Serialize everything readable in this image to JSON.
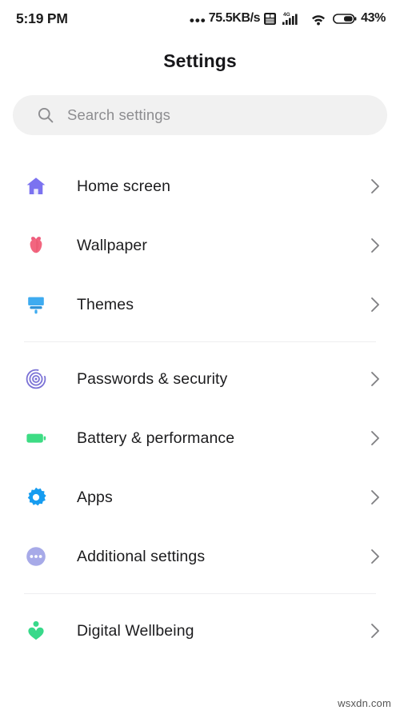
{
  "status_bar": {
    "clock": "5:19 PM",
    "network_prefix": "•••",
    "network_speed": "75.5KB/s",
    "sim_icon": "sim-card-icon",
    "network_type": "4G",
    "signal_icon": "cellular-signal-icon",
    "wifi_icon": "wifi-icon",
    "battery_icon": "battery-icon",
    "battery_percent": "43%"
  },
  "header": {
    "title": "Settings"
  },
  "search": {
    "icon": "search-icon",
    "placeholder": "Search settings",
    "value": ""
  },
  "colors": {
    "home": "#7b72f0",
    "wallpaper": "#f2667f",
    "themes": "#3eabf0",
    "passwords": "#7b72d6",
    "battery": "#3ddc84",
    "apps": "#169cf0",
    "additional": "#a7aae8",
    "wellbeing": "#38d98a",
    "search_bg": "#f1f1f1",
    "divider": "#eeeef0",
    "text": "#1c1c1e",
    "placeholder": "#8d8d90",
    "chevron": "#808083"
  },
  "groups": [
    {
      "items": [
        {
          "label": "Home screen",
          "icon": "home-icon",
          "color": "#7b72f0",
          "chevron": "chevron-right-icon"
        },
        {
          "label": "Wallpaper",
          "icon": "flower-icon",
          "color": "#f2667f",
          "chevron": "chevron-right-icon"
        },
        {
          "label": "Themes",
          "icon": "paint-brush-icon",
          "color": "#3eabf0",
          "chevron": "chevron-right-icon"
        }
      ]
    },
    {
      "items": [
        {
          "label": "Passwords & security",
          "icon": "fingerprint-icon",
          "color": "#7b72d6",
          "chevron": "chevron-right-icon"
        },
        {
          "label": "Battery & performance",
          "icon": "battery-icon",
          "color": "#3ddc84",
          "chevron": "chevron-right-icon"
        },
        {
          "label": "Apps",
          "icon": "gear-icon",
          "color": "#169cf0",
          "chevron": "chevron-right-icon"
        },
        {
          "label": "Additional settings",
          "icon": "three-dots-circle-icon",
          "color": "#a7aae8",
          "chevron": "chevron-right-icon"
        }
      ]
    },
    {
      "items": [
        {
          "label": "Digital Wellbeing",
          "icon": "person-heart-icon",
          "color": "#38d98a",
          "chevron": "chevron-right-icon"
        }
      ]
    }
  ],
  "watermark": "wsxdn.com"
}
